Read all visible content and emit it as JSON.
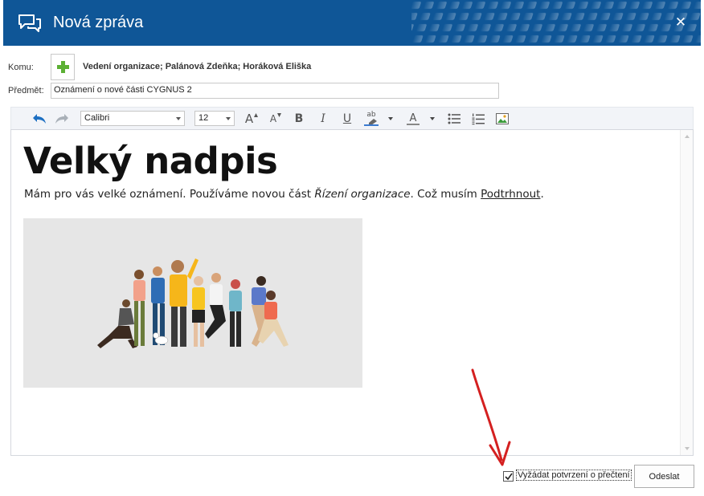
{
  "window": {
    "title": "Nová zpráva",
    "close_glyph": "✕"
  },
  "header": {
    "to_label": "Komu:",
    "recipients": "Vedení organizace; Palánová Zdeňka; Horáková Eliška",
    "subject_label": "Předmět:",
    "subject_value": "Oznámení o nové části CYGNUS 2"
  },
  "toolbar": {
    "font_name": "Calibri",
    "font_size": "12",
    "bold": "B",
    "italic": "I",
    "underline": "U",
    "font_color": "A",
    "highlight_text": "ab",
    "grow_glyph": "A",
    "shrink_glyph": "A"
  },
  "content": {
    "heading": "Velký nadpis",
    "para_part1": "Mám pro vás velké oznámení. Používáme novou část ",
    "para_italic": "Řízení organizace",
    "para_part2": ". Což musím ",
    "para_underlined": "Podtrhnout",
    "para_end": "."
  },
  "footer": {
    "read_receipt_label": "Vyžádat potvrzení o přečtení",
    "read_receipt_checked": true,
    "send_label": "Odeslat"
  },
  "colors": {
    "titlebar": "#0f5697",
    "add_icon": "#5cb034",
    "undo_icon": "#1d6fc2",
    "annotation_arrow": "#d42020"
  },
  "icons": [
    "chat-icon",
    "close-icon",
    "plus-icon",
    "undo-icon",
    "redo-icon",
    "grow-font-icon",
    "shrink-font-icon",
    "highlight-icon",
    "font-color-icon",
    "bullet-list-icon",
    "numbered-list-icon",
    "insert-image-icon",
    "checkmark-icon"
  ]
}
